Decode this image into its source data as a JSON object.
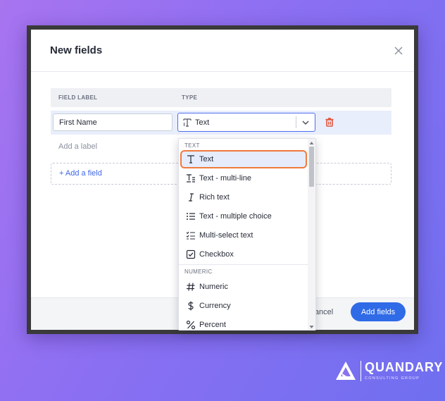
{
  "modal": {
    "title": "New fields",
    "columns": {
      "field_label": "FIELD LABEL",
      "type": "TYPE"
    },
    "field_row": {
      "label_value": "First Name",
      "type_value": "Text"
    },
    "add_label_placeholder": "Add a label",
    "add_field": "+ Add a field",
    "footer": {
      "cancel": "Cancel",
      "add_fields": "Add fields"
    }
  },
  "dropdown": {
    "sections": [
      {
        "title": "TEXT",
        "items": [
          {
            "label": "Text",
            "icon": "text-t-icon",
            "selected": true
          },
          {
            "label": "Text - multi-line",
            "icon": "text-multiline-icon"
          },
          {
            "label": "Rich text",
            "icon": "rich-text-icon"
          },
          {
            "label": "Text - multiple choice",
            "icon": "list-icon"
          },
          {
            "label": "Multi-select text",
            "icon": "checklist-icon"
          },
          {
            "label": "Checkbox",
            "icon": "checkbox-icon"
          }
        ]
      },
      {
        "title": "NUMERIC",
        "items": [
          {
            "label": "Numeric",
            "icon": "hash-icon"
          },
          {
            "label": "Currency",
            "icon": "dollar-icon"
          },
          {
            "label": "Percent",
            "icon": "percent-icon"
          }
        ]
      }
    ]
  },
  "brand": {
    "name": "QUANDARY",
    "tagline": "CONSULTING GROUP"
  },
  "colors": {
    "accent": "#2f6be7",
    "selection_highlight": "#f07a3c",
    "delete_icon": "#e0553d"
  }
}
